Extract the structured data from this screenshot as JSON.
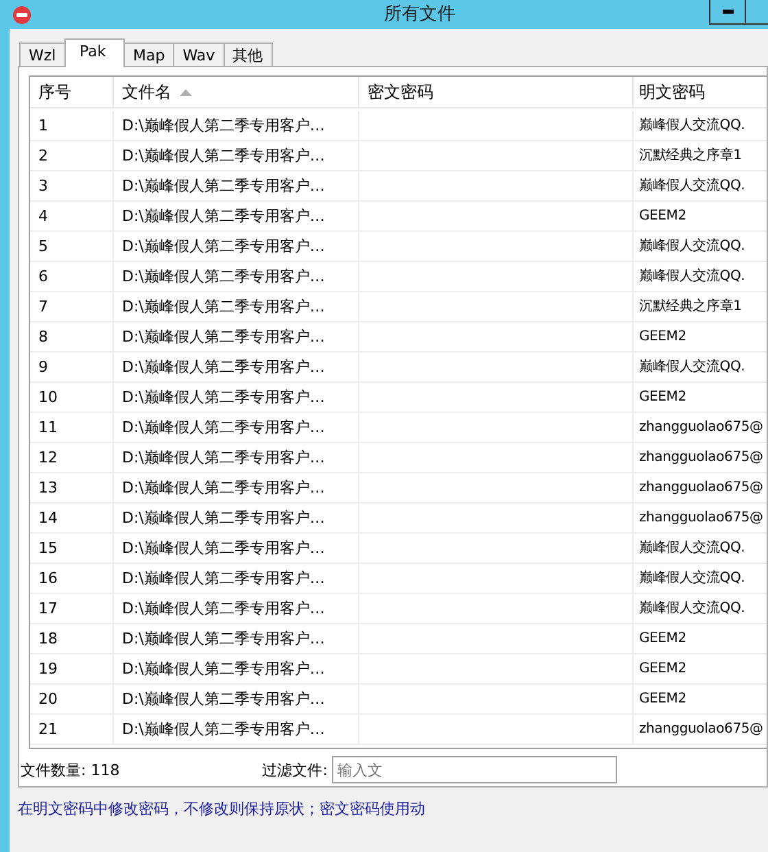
{
  "window": {
    "title": "所有文件"
  },
  "tabs": [
    {
      "label": "Wzl",
      "selected": false
    },
    {
      "label": "Pak",
      "selected": true
    },
    {
      "label": "Map",
      "selected": false
    },
    {
      "label": "Wav",
      "selected": false
    },
    {
      "label": "其他",
      "selected": false
    }
  ],
  "table": {
    "columns": [
      {
        "label": "序号",
        "sorted": false
      },
      {
        "label": "文件名",
        "sorted": true
      },
      {
        "label": "密文密码",
        "sorted": false
      },
      {
        "label": "明文密码",
        "sorted": false
      }
    ],
    "rows": [
      {
        "index": "1",
        "file": "D:\\巅峰假人第二季专用客户…",
        "plain": "巅峰假人交流QQ."
      },
      {
        "index": "2",
        "file": "D:\\巅峰假人第二季专用客户…",
        "plain": "沉默经典之序章1"
      },
      {
        "index": "3",
        "file": "D:\\巅峰假人第二季专用客户…",
        "plain": "巅峰假人交流QQ."
      },
      {
        "index": "4",
        "file": "D:\\巅峰假人第二季专用客户…",
        "plain": "GEEM2"
      },
      {
        "index": "5",
        "file": "D:\\巅峰假人第二季专用客户…",
        "plain": "巅峰假人交流QQ."
      },
      {
        "index": "6",
        "file": "D:\\巅峰假人第二季专用客户…",
        "plain": "巅峰假人交流QQ."
      },
      {
        "index": "7",
        "file": "D:\\巅峰假人第二季专用客户…",
        "plain": "沉默经典之序章1"
      },
      {
        "index": "8",
        "file": "D:\\巅峰假人第二季专用客户…",
        "plain": "GEEM2"
      },
      {
        "index": "9",
        "file": "D:\\巅峰假人第二季专用客户…",
        "plain": "巅峰假人交流QQ."
      },
      {
        "index": "10",
        "file": "D:\\巅峰假人第二季专用客户…",
        "plain": "GEEM2"
      },
      {
        "index": "11",
        "file": "D:\\巅峰假人第二季专用客户…",
        "plain": "zhangguolao675@"
      },
      {
        "index": "12",
        "file": "D:\\巅峰假人第二季专用客户…",
        "plain": "zhangguolao675@"
      },
      {
        "index": "13",
        "file": "D:\\巅峰假人第二季专用客户…",
        "plain": "zhangguolao675@"
      },
      {
        "index": "14",
        "file": "D:\\巅峰假人第二季专用客户…",
        "plain": "zhangguolao675@"
      },
      {
        "index": "15",
        "file": "D:\\巅峰假人第二季专用客户…",
        "plain": "巅峰假人交流QQ."
      },
      {
        "index": "16",
        "file": "D:\\巅峰假人第二季专用客户…",
        "plain": "巅峰假人交流QQ."
      },
      {
        "index": "17",
        "file": "D:\\巅峰假人第二季专用客户…",
        "plain": "巅峰假人交流QQ."
      },
      {
        "index": "18",
        "file": "D:\\巅峰假人第二季专用客户…",
        "plain": "GEEM2"
      },
      {
        "index": "19",
        "file": "D:\\巅峰假人第二季专用客户…",
        "plain": "GEEM2"
      },
      {
        "index": "20",
        "file": "D:\\巅峰假人第二季专用客户…",
        "plain": "GEEM2"
      },
      {
        "index": "21",
        "file": "D:\\巅峰假人第二季专用客户…",
        "plain": "zhangguolao675@"
      }
    ]
  },
  "footer": {
    "file_count": "文件数量: 118",
    "filter_label": "过滤文件:",
    "filter_placeholder": "输入文"
  },
  "status_bar": "在明文密码中修改密码，不修改则保持原状；密文密码使用动"
}
